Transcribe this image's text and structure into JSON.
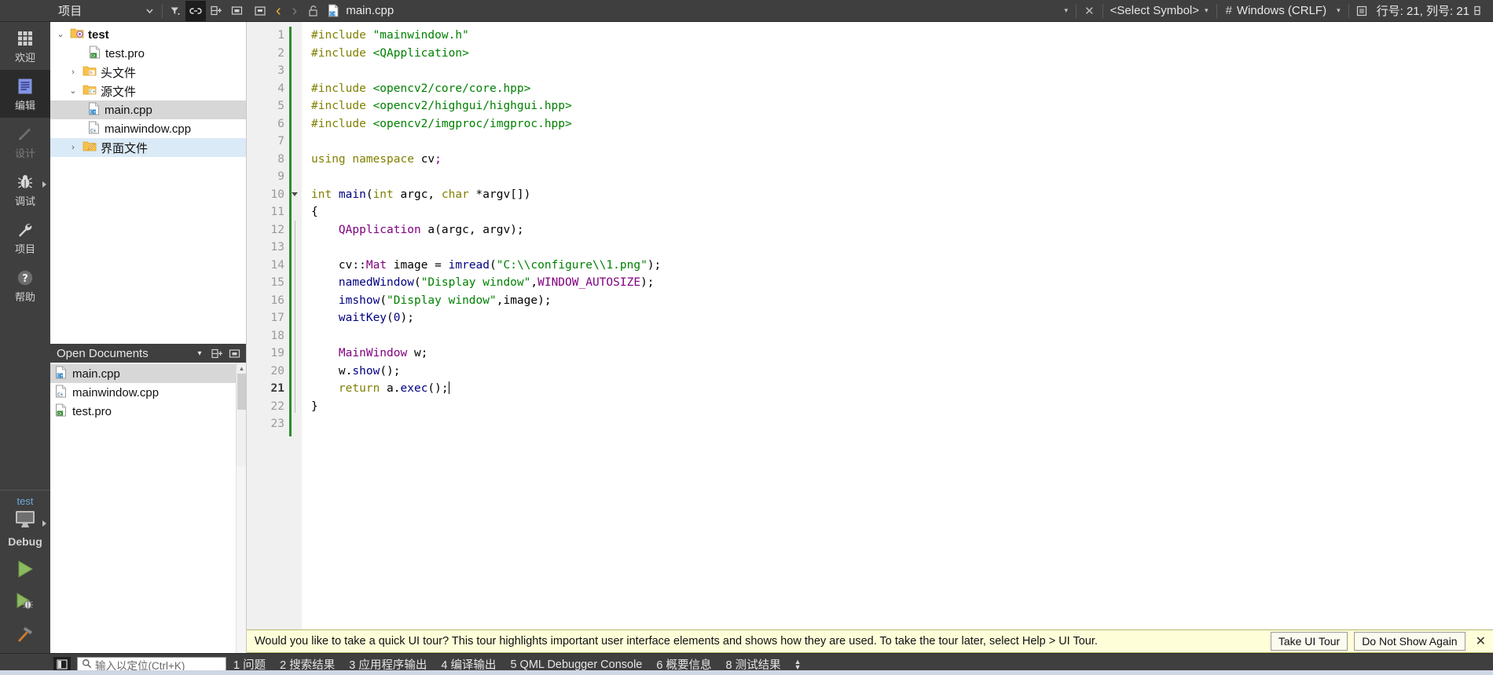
{
  "topbar": {
    "sidebar_toggle_icon": "sidebar-toggle-icon",
    "project_panel_title": "项目",
    "filter_icon": "filter-icon",
    "link_icon": "link-icon",
    "split_icon": "split-add-icon",
    "close_split_icon": "close-split-icon",
    "back_icon": "‹",
    "forward_icon": "›",
    "lock_icon": "unlock-icon",
    "file_name": "main.cpp",
    "file_dropdown_icon": "▾",
    "file_close_icon": "✕",
    "symbol_selector": "<Select Symbol>",
    "encoding_dropdown_icon": "▾",
    "line_ending_hash": "#",
    "line_ending": "Windows (CRLF)",
    "line_ending_caret": "▾",
    "line_col_icon": "line-column-icon",
    "line_col": "行号: 21, 列号: 21",
    "split_editor_icon": "split-editor-icon"
  },
  "modebar": {
    "items": [
      {
        "label": "欢迎",
        "icon": "grid-icon",
        "state": "normal"
      },
      {
        "label": "编辑",
        "icon": "document-lines-icon",
        "state": "selected"
      },
      {
        "label": "设计",
        "icon": "pencil-icon",
        "state": "disabled"
      },
      {
        "label": "调试",
        "icon": "bug-icon",
        "state": "normal",
        "arrow": true
      },
      {
        "label": "项目",
        "icon": "wrench-icon",
        "state": "normal"
      },
      {
        "label": "帮助",
        "icon": "question-circle-icon",
        "state": "normal"
      }
    ],
    "kit": {
      "target": "test",
      "build_config": "Debug",
      "monitor_icon": "monitor-icon",
      "arrow_icon": "▸"
    },
    "run_buttons": [
      {
        "name": "run-button",
        "icon": "green-play-icon"
      },
      {
        "name": "debug-button",
        "icon": "play-bug-icon"
      },
      {
        "name": "build-button",
        "icon": "hammer-icon"
      }
    ]
  },
  "project_tree": {
    "rows": [
      {
        "twist": "⌄",
        "icon": "folder-qt-icon",
        "label": "test",
        "indent": 0,
        "bold": true,
        "highlight": "none"
      },
      {
        "twist": "",
        "icon": "file-pro-icon",
        "label": "test.pro",
        "indent": 1,
        "bold": false,
        "highlight": "none"
      },
      {
        "twist": "›",
        "icon": "folder-h-icon",
        "label": "头文件",
        "indent": 1,
        "bold": false,
        "highlight": "none"
      },
      {
        "twist": "⌄",
        "icon": "folder-cpp-icon",
        "label": "源文件",
        "indent": 1,
        "bold": false,
        "highlight": "none"
      },
      {
        "twist": "",
        "icon": "file-cpp-icon",
        "label": "main.cpp",
        "indent": 2,
        "bold": false,
        "highlight": "grey"
      },
      {
        "twist": "",
        "icon": "file-cpp-icon",
        "label": "mainwindow.cpp",
        "indent": 2,
        "bold": false,
        "highlight": "none"
      },
      {
        "twist": "›",
        "icon": "folder-ui-icon",
        "label": "界面文件",
        "indent": 1,
        "bold": false,
        "highlight": "blue"
      }
    ]
  },
  "open_documents": {
    "title": "Open Documents",
    "dropdown_icon": "▾",
    "split_icon": "split-add-icon",
    "close_icon": "close-split-icon",
    "items": [
      {
        "icon": "file-cpp-icon",
        "label": "main.cpp",
        "selected": true
      },
      {
        "icon": "file-cpp-icon",
        "label": "mainwindow.cpp",
        "selected": false
      },
      {
        "icon": "file-pro-icon",
        "label": "test.pro",
        "selected": false
      }
    ]
  },
  "editor": {
    "current_line": 21,
    "lines": [
      {
        "n": 1,
        "fold": false,
        "tokens": [
          {
            "t": "#include ",
            "c": "pre"
          },
          {
            "t": "\"mainwindow.h\"",
            "c": "str"
          }
        ]
      },
      {
        "n": 2,
        "fold": false,
        "tokens": [
          {
            "t": "#include ",
            "c": "pre"
          },
          {
            "t": "<QApplication>",
            "c": "str"
          }
        ]
      },
      {
        "n": 3,
        "fold": false,
        "tokens": []
      },
      {
        "n": 4,
        "fold": false,
        "tokens": [
          {
            "t": "#include ",
            "c": "pre"
          },
          {
            "t": "<opencv2/core/core.hpp>",
            "c": "str"
          }
        ]
      },
      {
        "n": 5,
        "fold": false,
        "tokens": [
          {
            "t": "#include ",
            "c": "pre"
          },
          {
            "t": "<opencv2/highgui/highgui.hpp>",
            "c": "str"
          }
        ]
      },
      {
        "n": 6,
        "fold": false,
        "tokens": [
          {
            "t": "#include ",
            "c": "pre"
          },
          {
            "t": "<opencv2/imgproc/imgproc.hpp>",
            "c": "str"
          }
        ]
      },
      {
        "n": 7,
        "fold": false,
        "tokens": []
      },
      {
        "n": 8,
        "fold": false,
        "tokens": [
          {
            "t": "using namespace ",
            "c": "kw"
          },
          {
            "t": "cv",
            "c": "var"
          },
          {
            "t": ";",
            "c": "type"
          }
        ]
      },
      {
        "n": 9,
        "fold": false,
        "tokens": []
      },
      {
        "n": 10,
        "fold": true,
        "tokens": [
          {
            "t": "int ",
            "c": "kw"
          },
          {
            "t": "main",
            "c": "fn"
          },
          {
            "t": "(",
            "c": "pln"
          },
          {
            "t": "int ",
            "c": "kw"
          },
          {
            "t": "argc",
            "c": "var"
          },
          {
            "t": ", ",
            "c": "pln"
          },
          {
            "t": "char ",
            "c": "kw"
          },
          {
            "t": "*argv[])",
            "c": "pln"
          }
        ]
      },
      {
        "n": 11,
        "fold": false,
        "tokens": [
          {
            "t": "{",
            "c": "pln"
          }
        ]
      },
      {
        "n": 12,
        "fold": false,
        "tokens": [
          {
            "t": "    ",
            "c": "pln"
          },
          {
            "t": "QApplication",
            "c": "type"
          },
          {
            "t": " a(",
            "c": "pln"
          },
          {
            "t": "argc",
            "c": "var"
          },
          {
            "t": ", ",
            "c": "pln"
          },
          {
            "t": "argv",
            "c": "var"
          },
          {
            "t": ");",
            "c": "pln"
          }
        ]
      },
      {
        "n": 13,
        "fold": false,
        "tokens": []
      },
      {
        "n": 14,
        "fold": false,
        "tokens": [
          {
            "t": "    ",
            "c": "pln"
          },
          {
            "t": "cv",
            "c": "pln"
          },
          {
            "t": "::",
            "c": "pln"
          },
          {
            "t": "Mat",
            "c": "type"
          },
          {
            "t": " image = ",
            "c": "pln"
          },
          {
            "t": "imread",
            "c": "fn"
          },
          {
            "t": "(",
            "c": "pln"
          },
          {
            "t": "\"C:\\\\configure\\\\1.png\"",
            "c": "str"
          },
          {
            "t": ");",
            "c": "pln"
          }
        ]
      },
      {
        "n": 15,
        "fold": false,
        "tokens": [
          {
            "t": "    ",
            "c": "pln"
          },
          {
            "t": "namedWindow",
            "c": "fn"
          },
          {
            "t": "(",
            "c": "pln"
          },
          {
            "t": "\"Display window\"",
            "c": "str"
          },
          {
            "t": ",",
            "c": "pln"
          },
          {
            "t": "WINDOW_AUTOSIZE",
            "c": "type"
          },
          {
            "t": ");",
            "c": "pln"
          }
        ]
      },
      {
        "n": 16,
        "fold": false,
        "tokens": [
          {
            "t": "    ",
            "c": "pln"
          },
          {
            "t": "imshow",
            "c": "fn"
          },
          {
            "t": "(",
            "c": "pln"
          },
          {
            "t": "\"Display window\"",
            "c": "str"
          },
          {
            "t": ",image);",
            "c": "pln"
          }
        ]
      },
      {
        "n": 17,
        "fold": false,
        "tokens": [
          {
            "t": "    ",
            "c": "pln"
          },
          {
            "t": "waitKey",
            "c": "fn"
          },
          {
            "t": "(",
            "c": "pln"
          },
          {
            "t": "0",
            "c": "num"
          },
          {
            "t": ");",
            "c": "pln"
          }
        ]
      },
      {
        "n": 18,
        "fold": false,
        "tokens": []
      },
      {
        "n": 19,
        "fold": false,
        "tokens": [
          {
            "t": "    ",
            "c": "pln"
          },
          {
            "t": "MainWindow",
            "c": "type"
          },
          {
            "t": " w;",
            "c": "pln"
          }
        ]
      },
      {
        "n": 20,
        "fold": false,
        "tokens": [
          {
            "t": "    w.",
            "c": "pln"
          },
          {
            "t": "show",
            "c": "fn"
          },
          {
            "t": "();",
            "c": "pln"
          }
        ]
      },
      {
        "n": 21,
        "fold": false,
        "caret": true,
        "tokens": [
          {
            "t": "    ",
            "c": "pln"
          },
          {
            "t": "return ",
            "c": "kw"
          },
          {
            "t": "a.",
            "c": "pln"
          },
          {
            "t": "exec",
            "c": "fn"
          },
          {
            "t": "();",
            "c": "pln"
          }
        ]
      },
      {
        "n": 22,
        "fold": false,
        "tokens": [
          {
            "t": "}",
            "c": "pln"
          }
        ]
      },
      {
        "n": 23,
        "fold": false,
        "tokens": []
      }
    ]
  },
  "notification": {
    "message": "Would you like to take a quick UI tour? This tour highlights important user interface elements and shows how they are used. To take the tour later, select Help > UI Tour.",
    "take_tour_label": "Take UI Tour",
    "dismiss_label": "Do Not Show Again",
    "close_icon": "✕"
  },
  "statusbar": {
    "sidebar_toggle_icon": "sidebar-toggle-icon",
    "locator_icon": "search-icon",
    "locator_placeholder": "输入以定位(Ctrl+K)",
    "panes": [
      {
        "num": "1",
        "label": "问题"
      },
      {
        "num": "2",
        "label": "搜索结果"
      },
      {
        "num": "3",
        "label": "应用程序输出"
      },
      {
        "num": "4",
        "label": "编译输出"
      },
      {
        "num": "5",
        "label": "QML Debugger Console"
      },
      {
        "num": "6",
        "label": "概要信息"
      },
      {
        "num": "8",
        "label": "测试结果"
      }
    ],
    "updown_icon": "▲▼"
  },
  "colors": {
    "chrome": "#3f3f3f",
    "selected_mode": "#2b2b2b",
    "tree_select_grey": "#d7d7d7",
    "tree_select_blue": "#dbeaf7",
    "notification_bg": "#feffd9",
    "accent_yellow": "#e8b33c",
    "string_green": "#008000",
    "type_purple": "#800080",
    "function_navy": "#000080",
    "keyword_olive": "#808000"
  }
}
